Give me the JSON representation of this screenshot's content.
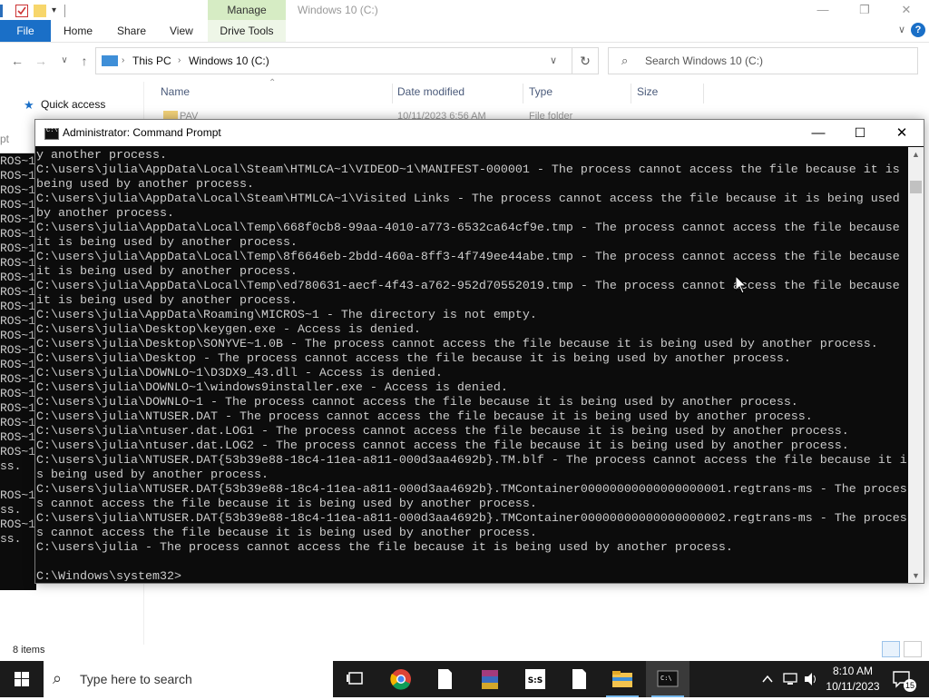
{
  "explorer": {
    "title": "Windows 10 (C:)",
    "manage_tab": "Manage",
    "drive_tools_tab": "Drive Tools",
    "ribbon_tabs": [
      "File",
      "Home",
      "Share",
      "View"
    ],
    "breadcrumb": [
      "This PC",
      "Windows 10 (C:)"
    ],
    "search_placeholder": "Search Windows 10 (C:)",
    "nav_quick_access": "Quick access",
    "columns": [
      "Name",
      "Date modified",
      "Type",
      "Size"
    ],
    "first_row": {
      "name": "PAV",
      "date": "10/11/2023 6:56 AM",
      "type": "File folder"
    },
    "status_items": "8 items"
  },
  "background_window": {
    "title_fragment": "pt",
    "lines": [
      "ROS~1",
      "ROS~1",
      "ROS~1",
      "ROS~1",
      "ROS~1",
      "ROS~1",
      "ROS~1",
      "ROS~1",
      "ROS~1",
      "ROS~1",
      "ROS~1",
      "ROS~1",
      "ROS~1",
      "ROS~1",
      "ROS~1",
      "ROS~1",
      "ROS~1",
      "ROS~1",
      "ROS~1",
      "ROS~1",
      "ROS~1",
      "ss.",
      "",
      "ROS~1",
      "ss.",
      "ROS~1",
      "ss."
    ]
  },
  "cmd": {
    "title": "Administrator: Command Prompt",
    "lines": [
      "y another process.",
      "C:\\users\\julia\\AppData\\Local\\Steam\\HTMLCA~1\\VIDEOD~1\\MANIFEST-000001 - The process cannot access the file because it is",
      "being used by another process.",
      "C:\\users\\julia\\AppData\\Local\\Steam\\HTMLCA~1\\Visited Links - The process cannot access the file because it is being used",
      "by another process.",
      "C:\\users\\julia\\AppData\\Local\\Temp\\668f0cb8-99aa-4010-a773-6532ca64cf9e.tmp - The process cannot access the file because",
      "it is being used by another process.",
      "C:\\users\\julia\\AppData\\Local\\Temp\\8f6646eb-2bdd-460a-8ff3-4f749ee44abe.tmp - The process cannot access the file because",
      "it is being used by another process.",
      "C:\\users\\julia\\AppData\\Local\\Temp\\ed780631-aecf-4f43-a762-952d70552019.tmp - The process cannot access the file because",
      "it is being used by another process.",
      "C:\\users\\julia\\AppData\\Roaming\\MICROS~1 - The directory is not empty.",
      "C:\\users\\julia\\Desktop\\keygen.exe - Access is denied.",
      "C:\\users\\julia\\Desktop\\SONYVE~1.0B - The process cannot access the file because it is being used by another process.",
      "C:\\users\\julia\\Desktop - The process cannot access the file because it is being used by another process.",
      "C:\\users\\julia\\DOWNLO~1\\D3DX9_43.dll - Access is denied.",
      "C:\\users\\julia\\DOWNLO~1\\windows9installer.exe - Access is denied.",
      "C:\\users\\julia\\DOWNLO~1 - The process cannot access the file because it is being used by another process.",
      "C:\\users\\julia\\NTUSER.DAT - The process cannot access the file because it is being used by another process.",
      "C:\\users\\julia\\ntuser.dat.LOG1 - The process cannot access the file because it is being used by another process.",
      "C:\\users\\julia\\ntuser.dat.LOG2 - The process cannot access the file because it is being used by another process.",
      "C:\\users\\julia\\NTUSER.DAT{53b39e88-18c4-11ea-a811-000d3aa4692b}.TM.blf - The process cannot access the file because it i",
      "s being used by another process.",
      "C:\\users\\julia\\NTUSER.DAT{53b39e88-18c4-11ea-a811-000d3aa4692b}.TMContainer00000000000000000001.regtrans-ms - The proces",
      "s cannot access the file because it is being used by another process.",
      "C:\\users\\julia\\NTUSER.DAT{53b39e88-18c4-11ea-a811-000d3aa4692b}.TMContainer00000000000000000002.regtrans-ms - The proces",
      "s cannot access the file because it is being used by another process.",
      "C:\\users\\julia - The process cannot access the file because it is being used by another process.",
      "",
      "C:\\Windows\\system32>"
    ]
  },
  "taskbar": {
    "search_placeholder": "Type here to search",
    "time": "8:10 AM",
    "date": "10/11/2023",
    "notification_count": "15",
    "apps": [
      "task-view",
      "chrome",
      "file",
      "winrar",
      "sas",
      "file",
      "file-explorer",
      "command-prompt"
    ]
  }
}
